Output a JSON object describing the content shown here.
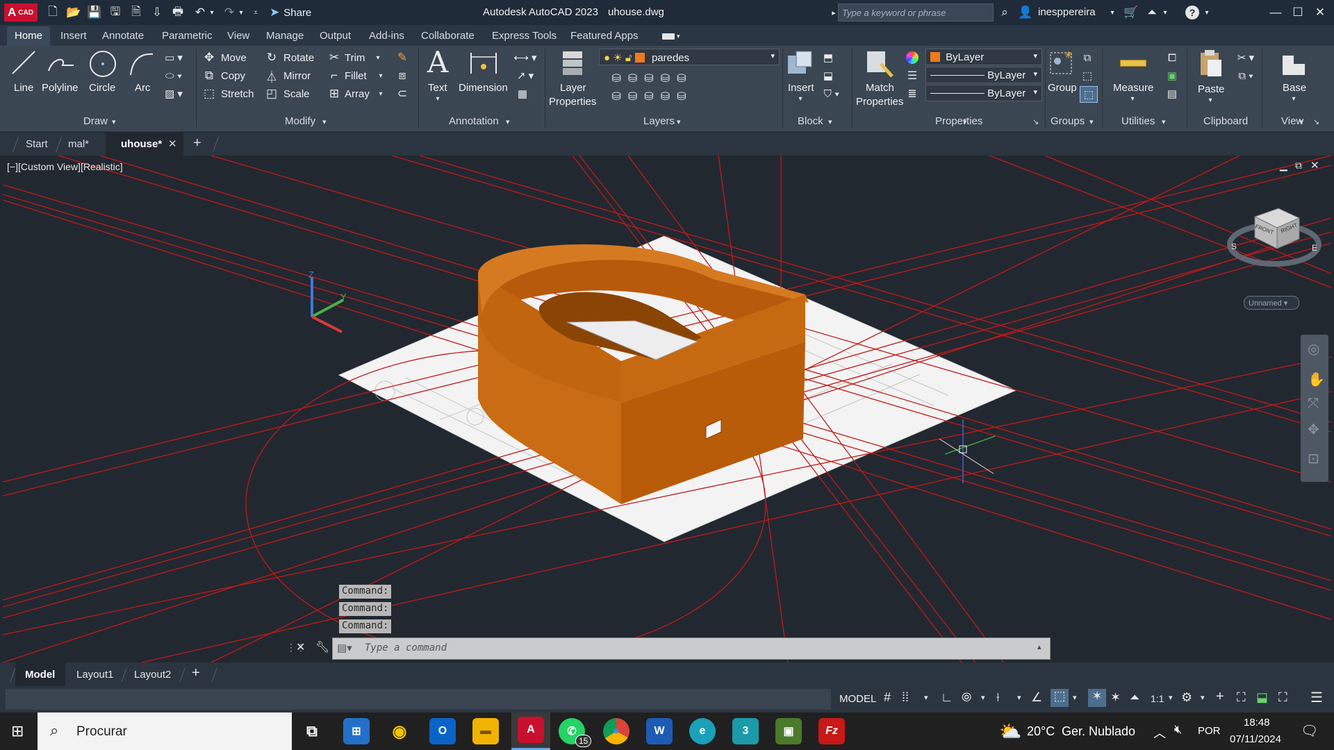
{
  "titlebar": {
    "app_badge": "A",
    "app_badge_sub": "CAD",
    "share": "Share",
    "title": "Autodesk AutoCAD 2023",
    "filename": "uhouse.dwg",
    "search_placeholder": "Type a keyword or phrase",
    "username": "inesppereira"
  },
  "ribbon_tabs": [
    "Home",
    "Insert",
    "Annotate",
    "Parametric",
    "View",
    "Manage",
    "Output",
    "Add-ins",
    "Collaborate",
    "Express Tools",
    "Featured Apps"
  ],
  "ribbon": {
    "draw": {
      "title": "Draw",
      "line": "Line",
      "polyline": "Polyline",
      "circle": "Circle",
      "arc": "Arc"
    },
    "modify": {
      "title": "Modify",
      "move": "Move",
      "rotate": "Rotate",
      "trim": "Trim",
      "copy": "Copy",
      "mirror": "Mirror",
      "fillet": "Fillet",
      "stretch": "Stretch",
      "scale": "Scale",
      "array": "Array"
    },
    "annotation": {
      "title": "Annotation",
      "text": "Text",
      "dimension": "Dimension"
    },
    "layers": {
      "title": "Layers",
      "layer_properties_1": "Layer",
      "layer_properties_2": "Properties",
      "current_layer": "paredes",
      "layer_color": "#f07a1a"
    },
    "block": {
      "title": "Block",
      "insert": "Insert"
    },
    "properties": {
      "title": "Properties",
      "match_1": "Match",
      "match_2": "Properties",
      "color": "ByLayer",
      "linetype": "ByLayer",
      "lineweight": "ByLayer"
    },
    "groups": {
      "title": "Groups",
      "group": "Group"
    },
    "utilities": {
      "title": "Utilities",
      "measure": "Measure"
    },
    "clipboard": {
      "title": "Clipboard",
      "paste": "Paste"
    },
    "view": {
      "title": "View",
      "base": "Base"
    }
  },
  "doc_tabs": {
    "start": "Start",
    "tab1": "mal*",
    "tab2": "uhouse*"
  },
  "viewport": {
    "label": "[−][Custom View][Realistic]",
    "viewcube_front": "FRONT",
    "viewcube_right": "RIGHT",
    "compass_s": "S",
    "compass_e": "E",
    "ucs_name": "Unnamed",
    "axis_z": "Z",
    "axis_y": "Y"
  },
  "command": {
    "history": [
      "Command:",
      "Command:",
      "Command:"
    ],
    "placeholder": "Type a command"
  },
  "layout_tabs": [
    "Model",
    "Layout1",
    "Layout2"
  ],
  "status": {
    "model": "MODEL",
    "scale": "1:1"
  },
  "taskbar": {
    "search": "Procurar",
    "weather_temp": "20°C",
    "weather_text": "Ger. Nublado",
    "lang": "POR",
    "time": "18:48",
    "date": "07/11/2024",
    "whatsapp_badge": "15"
  },
  "colors": {
    "wall": "#c8660e",
    "redline": "#d42020",
    "ribbon": "#3b4653",
    "viewport": "#212830"
  }
}
